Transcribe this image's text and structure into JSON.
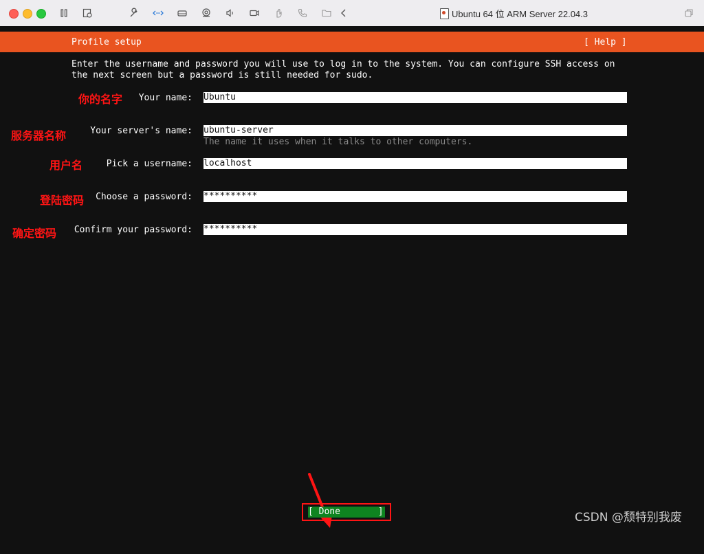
{
  "window": {
    "title": "Ubuntu 64 位 ARM Server 22.04.3",
    "toolbar_icons": [
      "pause-icon",
      "snapshot-icon",
      "wrench-icon",
      "network-icon",
      "disk-icon",
      "camera-icon",
      "sound-icon",
      "video-icon",
      "usb-icon",
      "phone-icon",
      "shared-folder-icon",
      "back-chevron-icon",
      "fullscreen-icon"
    ]
  },
  "header": {
    "title": "Profile setup",
    "help": "[ Help ]",
    "bar_color": "#e95420"
  },
  "intro": {
    "line1": "Enter the username and password you will use to log in to the system. You can configure SSH access on",
    "line2": "the next screen but a password is still needed for sudo."
  },
  "fields": [
    {
      "label": "Your name:",
      "value": "Ubuntu",
      "annotation": "你的名字"
    },
    {
      "label": "Your server's name:",
      "value": "ubuntu-server",
      "hint": "The name it uses when it talks to other computers.",
      "annotation": "服务器名称"
    },
    {
      "label": "Pick a username:",
      "value": "localhost",
      "annotation": "用户名"
    },
    {
      "label": "Choose a password:",
      "value": "**********",
      "annotation": "登陆密码"
    },
    {
      "label": "Confirm your password:",
      "value": "**********",
      "annotation": "确定密码"
    }
  ],
  "done_button": {
    "label": "[ Done       ]",
    "color": "#0e8420",
    "highlight_color": "#ff1414"
  },
  "watermark": "CSDN @颓特别我废"
}
